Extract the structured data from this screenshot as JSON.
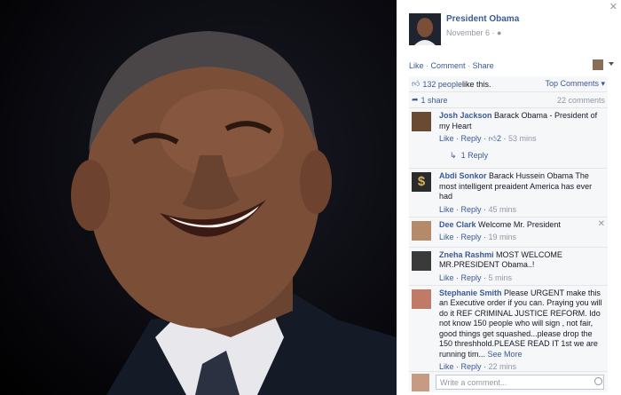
{
  "post": {
    "author": "President Obama",
    "date": "November 6 ·",
    "audience_icon": "globe-icon"
  },
  "actions": {
    "like": "Like",
    "comment": "Comment",
    "share": "Share",
    "sep": "·"
  },
  "feedback": {
    "likes_count": "132 people",
    "likes_suffix": " like this.",
    "top_comments": "Top Comments",
    "shares": "1 share",
    "comments_count": "22 comments"
  },
  "comments": [
    {
      "name": "Josh Jackson",
      "text": " Barack Obama - President of my Heart",
      "like": "Like",
      "reply": "Reply",
      "likes": "2",
      "time": "53 mins",
      "replies": "1 Reply"
    },
    {
      "name": "Abdi Sonkor",
      "text": " Barack Hussein Obama The most intelligent preaident America has ever had",
      "like": "Like",
      "reply": "Reply",
      "time": "45 mins"
    },
    {
      "name": "Dee Clark",
      "text": " Welcome Mr. President",
      "like": "Like",
      "reply": "Reply",
      "time": "19 mins"
    },
    {
      "name": "Zneha Rashmi",
      "text": " MOST WELCOME MR.PRESIDENT Obama..!",
      "like": "Like",
      "reply": "Reply",
      "time": "5 mins"
    },
    {
      "name": "Stephanie Smith",
      "text": " Please URGENT make this an Executive order if you can. Praying you will do it REF CRIMINAL JUSTICE REFORM. Ido not know 150 people who will sign , not fair, good things get squashed...please drop the 150 threshhold.PLEASE READ IT 1st we are running tim...",
      "see_more": "See More",
      "like": "Like",
      "reply": "Reply",
      "time": "22 mins"
    }
  ],
  "composer": {
    "placeholder": "Write a comment..."
  },
  "colors": {
    "link": "#3b5998",
    "muted": "#9197a3",
    "panel_bg": "#f6f7f9"
  }
}
